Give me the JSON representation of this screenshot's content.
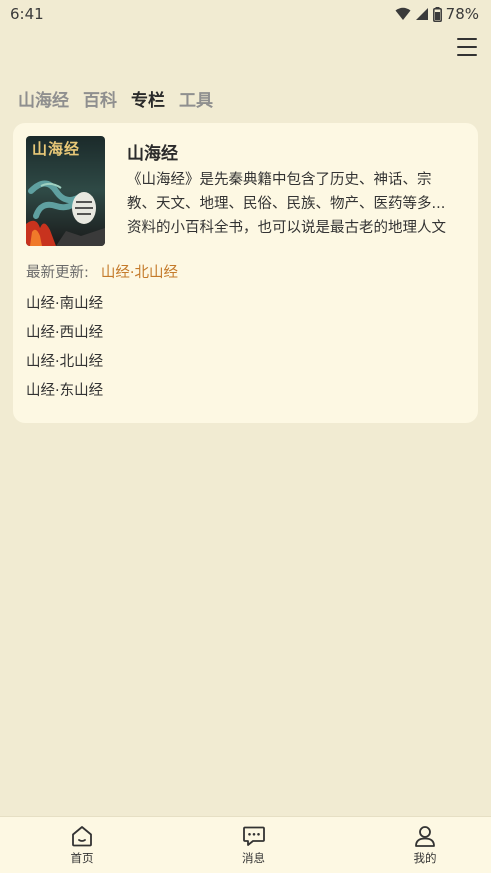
{
  "status": {
    "time": "6:41",
    "battery": "78%"
  },
  "tabs": [
    {
      "label": "山海经"
    },
    {
      "label": "百科"
    },
    {
      "label": "专栏"
    },
    {
      "label": "工具"
    }
  ],
  "book": {
    "title": "山海经",
    "cover_text": "山海经",
    "desc_lines": [
      "《山海经》是先秦典籍中包含了历史、神话、宗",
      "教、天文、地理、民俗、民族、物产、医药等多...",
      "资料的小百科全书，也可以说是最古老的地理人文"
    ],
    "latest_label": "最新更新:",
    "latest_link": "山经·北山经",
    "chapters": [
      "山经·南山经",
      "山经·西山经",
      "山经·北山经",
      "山经·东山经"
    ]
  },
  "nav": [
    {
      "label": "首页",
      "icon": "home-icon"
    },
    {
      "label": "消息",
      "icon": "message-icon"
    },
    {
      "label": "我的",
      "icon": "user-icon"
    }
  ],
  "colors": {
    "background": "#f1ebd2",
    "card": "#fdf8e3",
    "accent": "#c47a2a"
  }
}
